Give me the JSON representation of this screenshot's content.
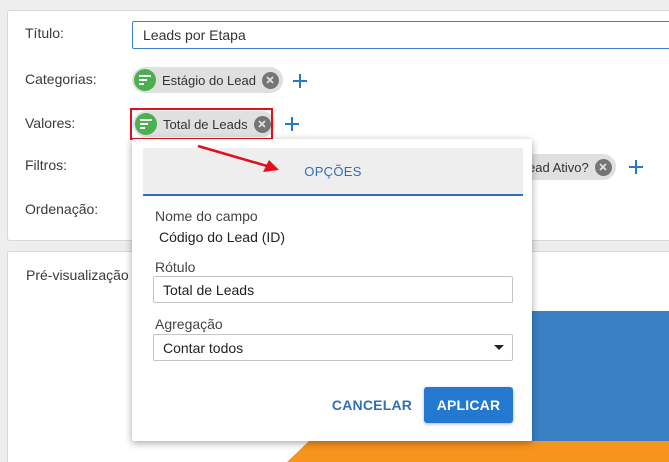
{
  "form": {
    "title_label": "Título:",
    "title_value": "Leads por Etapa",
    "categories_label": "Categorias:",
    "categories_chip": "Estágio do Lead",
    "values_label": "Valores:",
    "values_chip": "Total de Leads",
    "filters_label": "Filtros:",
    "filters_chip": "ead Ativo?",
    "ordering_label": "Ordenação:"
  },
  "popup": {
    "tab_label": "OPÇÕES",
    "field_name_label": "Nome do campo",
    "field_name_value": "Código do Lead (ID)",
    "label_label": "Rótulo",
    "label_value": "Total de Leads",
    "aggregation_label": "Agregação",
    "aggregation_value": "Contar todos",
    "cancel_label": "CANCELAR",
    "apply_label": "APLICAR"
  },
  "preview": {
    "title": "Pré-visualização d"
  },
  "colors": {
    "accent": "#2378cf",
    "chip_avatar": "#4caf50",
    "highlight": "#e0101e",
    "chart_blue": "#3a80c4",
    "chart_orange": "#f7941d"
  },
  "icons": {
    "chip_avatar": "filter-list-icon",
    "chip_remove": "close-circle-icon",
    "add": "plus-icon",
    "select": "caret-down-icon",
    "annotation": "red-arrow-icon"
  }
}
